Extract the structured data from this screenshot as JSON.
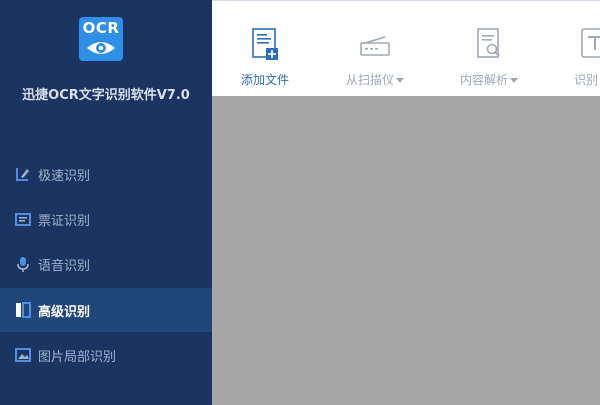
{
  "app": {
    "logo_text": "OCR",
    "title": "迅捷OCR文字识别软件V7.0"
  },
  "sidebar": {
    "items": [
      {
        "label": "极速识别",
        "icon": "fast-recognize-icon",
        "active": false
      },
      {
        "label": "票证识别",
        "icon": "ticket-icon",
        "active": false
      },
      {
        "label": "语音识别",
        "icon": "microphone-icon",
        "active": false
      },
      {
        "label": "高级识别",
        "icon": "advanced-recognize-icon",
        "active": true
      },
      {
        "label": "图片局部识别",
        "icon": "image-region-icon",
        "active": false
      }
    ]
  },
  "toolbar": {
    "items": [
      {
        "label": "添加文件",
        "icon": "add-file-icon",
        "has_dropdown": false
      },
      {
        "label": "从扫描仪",
        "icon": "scanner-icon",
        "has_dropdown": true
      },
      {
        "label": "内容解析",
        "icon": "content-parse-icon",
        "has_dropdown": true
      },
      {
        "label": "识别",
        "icon": "text-recognize-icon",
        "has_dropdown": false
      }
    ]
  },
  "colors": {
    "sidebar_bg": "#1b3462",
    "sidebar_active_bg": "#22457a",
    "accent": "#2f8ee6",
    "workspace_bg": "#a6a6a6"
  }
}
